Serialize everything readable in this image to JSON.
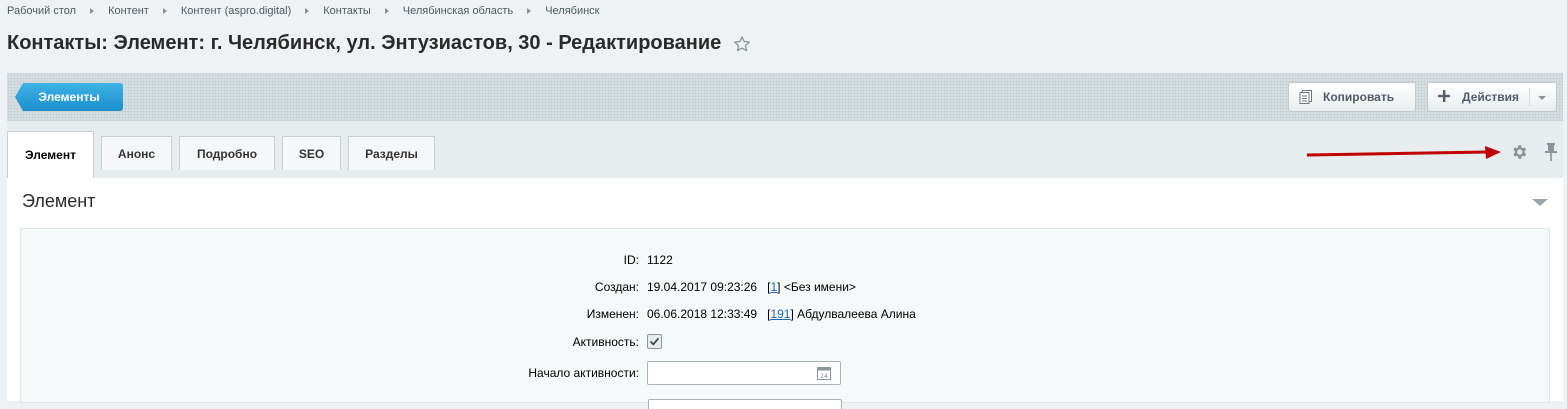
{
  "breadcrumbs": [
    "Рабочий стол",
    "Контент",
    "Контент (aspro.digital)",
    "Контакты",
    "Челябинская область",
    "Челябинск"
  ],
  "page_title": "Контакты: Элемент: г. Челябинск, ул. Энтузиастов, 30 - Редактирование",
  "toolbar": {
    "elements_label": "Элементы",
    "copy_label": "Копировать",
    "actions_label": "Действия"
  },
  "tabs": [
    "Элемент",
    "Анонс",
    "Подробно",
    "SEO",
    "Разделы"
  ],
  "section": {
    "title": "Элемент"
  },
  "fields": {
    "id_label": "ID:",
    "id_value": "1122",
    "created_label": "Создан:",
    "created_date": "19.04.2017 09:23:26",
    "created_user_id": "1",
    "created_user_name": "<Без имени>",
    "modified_label": "Изменен:",
    "modified_date": "06.06.2018 12:33:49",
    "modified_user_id": "191",
    "modified_user_name": "Абдулвалеева Алина",
    "active_label": "Активность:",
    "active_checked": true,
    "start_label": "Начало активности:",
    "start_value": ""
  },
  "colors": {
    "accent_blue": "#1a8fcd",
    "arrow_red": "#c00000",
    "link": "#2067b0"
  },
  "icons": [
    "star-icon",
    "copy-icon",
    "plus-icon",
    "gear-icon",
    "pin-icon",
    "calendar-icon",
    "checkmark-icon",
    "arrow-annotation"
  ]
}
